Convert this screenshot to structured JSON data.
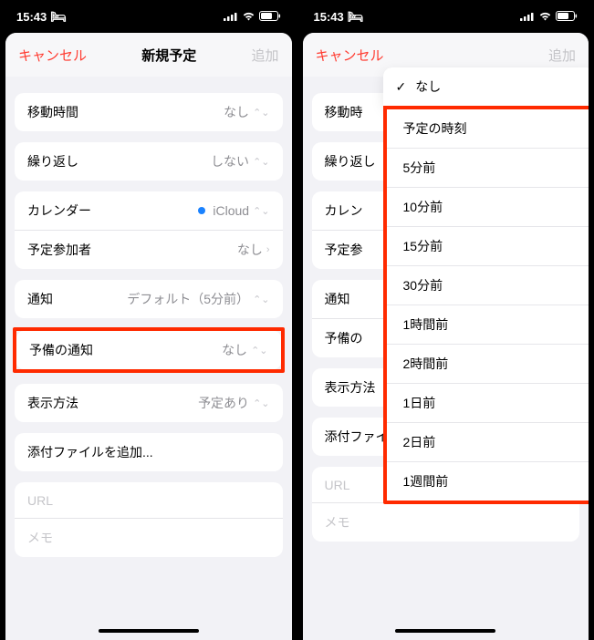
{
  "status": {
    "time": "15:43"
  },
  "nav": {
    "cancel": "キャンセル",
    "title": "新規予定",
    "add": "追加"
  },
  "rows": {
    "travel_time": {
      "label": "移動時間",
      "value": "なし"
    },
    "repeat": {
      "label": "繰り返し",
      "value": "しない"
    },
    "calendar": {
      "label": "カレンダー",
      "value": "iCloud"
    },
    "invitees": {
      "label": "予定参加者",
      "value": "なし"
    },
    "alert": {
      "label": "通知",
      "value": "デフォルト（5分前）"
    },
    "second_alert": {
      "label": "予備の通知",
      "value": "なし"
    },
    "show_as": {
      "label": "表示方法",
      "value": "予定あり"
    },
    "attachment": {
      "label": "添付ファイルを追加..."
    },
    "url": {
      "placeholder": "URL"
    },
    "memo": {
      "placeholder": "メモ"
    }
  },
  "rows_right": {
    "travel_time_short": {
      "label": "移動時",
      "value": ""
    },
    "calendar_short": {
      "label": "カレン",
      "value": ""
    },
    "invitees_short": {
      "label": "予定参",
      "value": ""
    },
    "second_alert_short": {
      "label": "予備の"
    }
  },
  "popup": {
    "selected": "なし",
    "options": [
      "予定の時刻",
      "5分前",
      "10分前",
      "15分前",
      "30分前",
      "1時間前",
      "2時間前",
      "1日前",
      "2日前",
      "1週間前"
    ]
  }
}
